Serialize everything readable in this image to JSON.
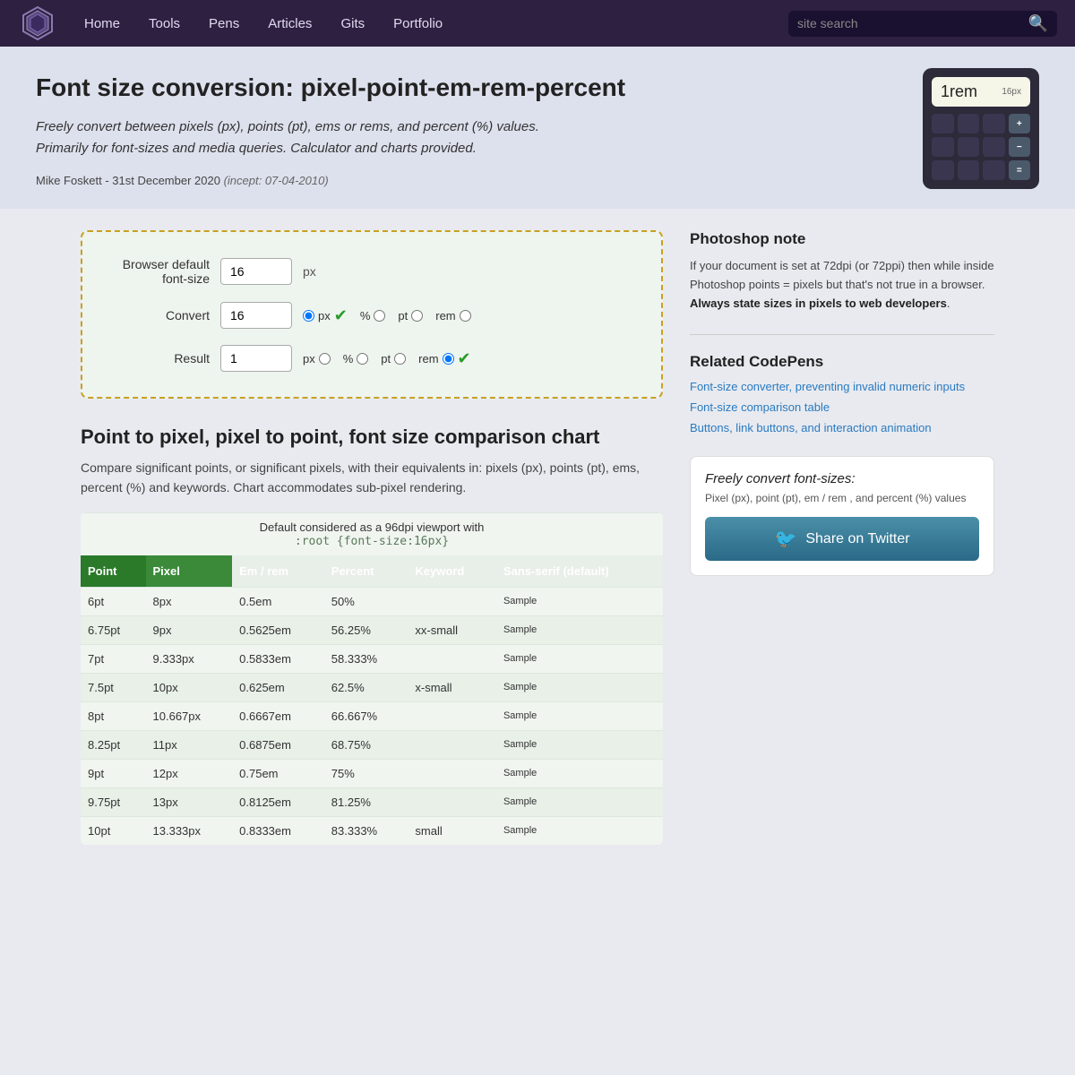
{
  "nav": {
    "links": [
      "Home",
      "Tools",
      "Pens",
      "Articles",
      "Gits",
      "Portfolio"
    ],
    "search_placeholder": "site search"
  },
  "header": {
    "title": "Font size conversion: pixel-point-em-rem-percent",
    "description": "Freely convert between pixels (px), points (pt), ems or rems, and percent (%) values. Primarily for font-sizes and media queries. Calculator and charts provided.",
    "author": "Mike Foskett",
    "date": "31st December 2020",
    "incept": "(incept: 07-04-2010)"
  },
  "calc": {
    "display_val": "1rem",
    "display_unit": "16px",
    "buttons": [
      "",
      "",
      "",
      "",
      "",
      "",
      "",
      "",
      "",
      "",
      "",
      "",
      "",
      "",
      "",
      ""
    ]
  },
  "converter": {
    "default_label": "Browser default font-size",
    "default_value": "16",
    "default_unit": "px",
    "convert_label": "Convert",
    "convert_value": "16",
    "result_label": "Result",
    "result_value": "1",
    "units": {
      "px": "px",
      "percent": "%",
      "pt": "pt",
      "rem": "rem"
    }
  },
  "chart": {
    "section_title": "Point to pixel, pixel to point, font size comparison chart",
    "section_desc": "Compare significant points, or significant pixels, with their equivalents in: pixels (px), points (pt), ems, percent (%) and keywords. Chart accommodates sub-pixel rendering.",
    "caption": "Default considered as a 96dpi viewport with",
    "caption_code": ":root {font-size:16px}",
    "headers": [
      "Point",
      "Pixel",
      "Em / rem",
      "Percent",
      "Keyword",
      "Sans-serif (default)"
    ],
    "rows": [
      [
        "6pt",
        "8px",
        "0.5em",
        "50%",
        "",
        "Sample"
      ],
      [
        "6.75pt",
        "9px",
        "0.5625em",
        "56.25%",
        "xx-small",
        "Sample"
      ],
      [
        "7pt",
        "9.333px",
        "0.5833em",
        "58.333%",
        "",
        "Sample"
      ],
      [
        "7.5pt",
        "10px",
        "0.625em",
        "62.5%",
        "x-small",
        "Sample"
      ],
      [
        "8pt",
        "10.667px",
        "0.6667em",
        "66.667%",
        "",
        "Sample"
      ],
      [
        "8.25pt",
        "11px",
        "0.6875em",
        "68.75%",
        "",
        "Sample"
      ],
      [
        "9pt",
        "12px",
        "0.75em",
        "75%",
        "",
        "Sample"
      ],
      [
        "9.75pt",
        "13px",
        "0.8125em",
        "81.25%",
        "",
        "Sample"
      ],
      [
        "10pt",
        "13.333px",
        "0.8333em",
        "83.333%",
        "small",
        "Sample"
      ]
    ]
  },
  "sidebar": {
    "photoshop_heading": "Photoshop note",
    "photoshop_text": "If your document is set at 72dpi (or 72ppi) then while inside Photoshop points = pixels but that's not true in a browser.",
    "photoshop_bold": "Always state sizes in pixels to web developers",
    "codepens_heading": "Related CodePens",
    "codepen_links": [
      "Font-size converter, preventing invalid numeric inputs",
      "Font-size comparison table",
      "Buttons, link buttons, and interaction animation"
    ],
    "twitter_card_title": "Freely convert font-sizes:",
    "twitter_card_desc": "Pixel (px), point (pt), em / rem , and percent (%) values",
    "twitter_btn_label": "Share on Twitter"
  }
}
